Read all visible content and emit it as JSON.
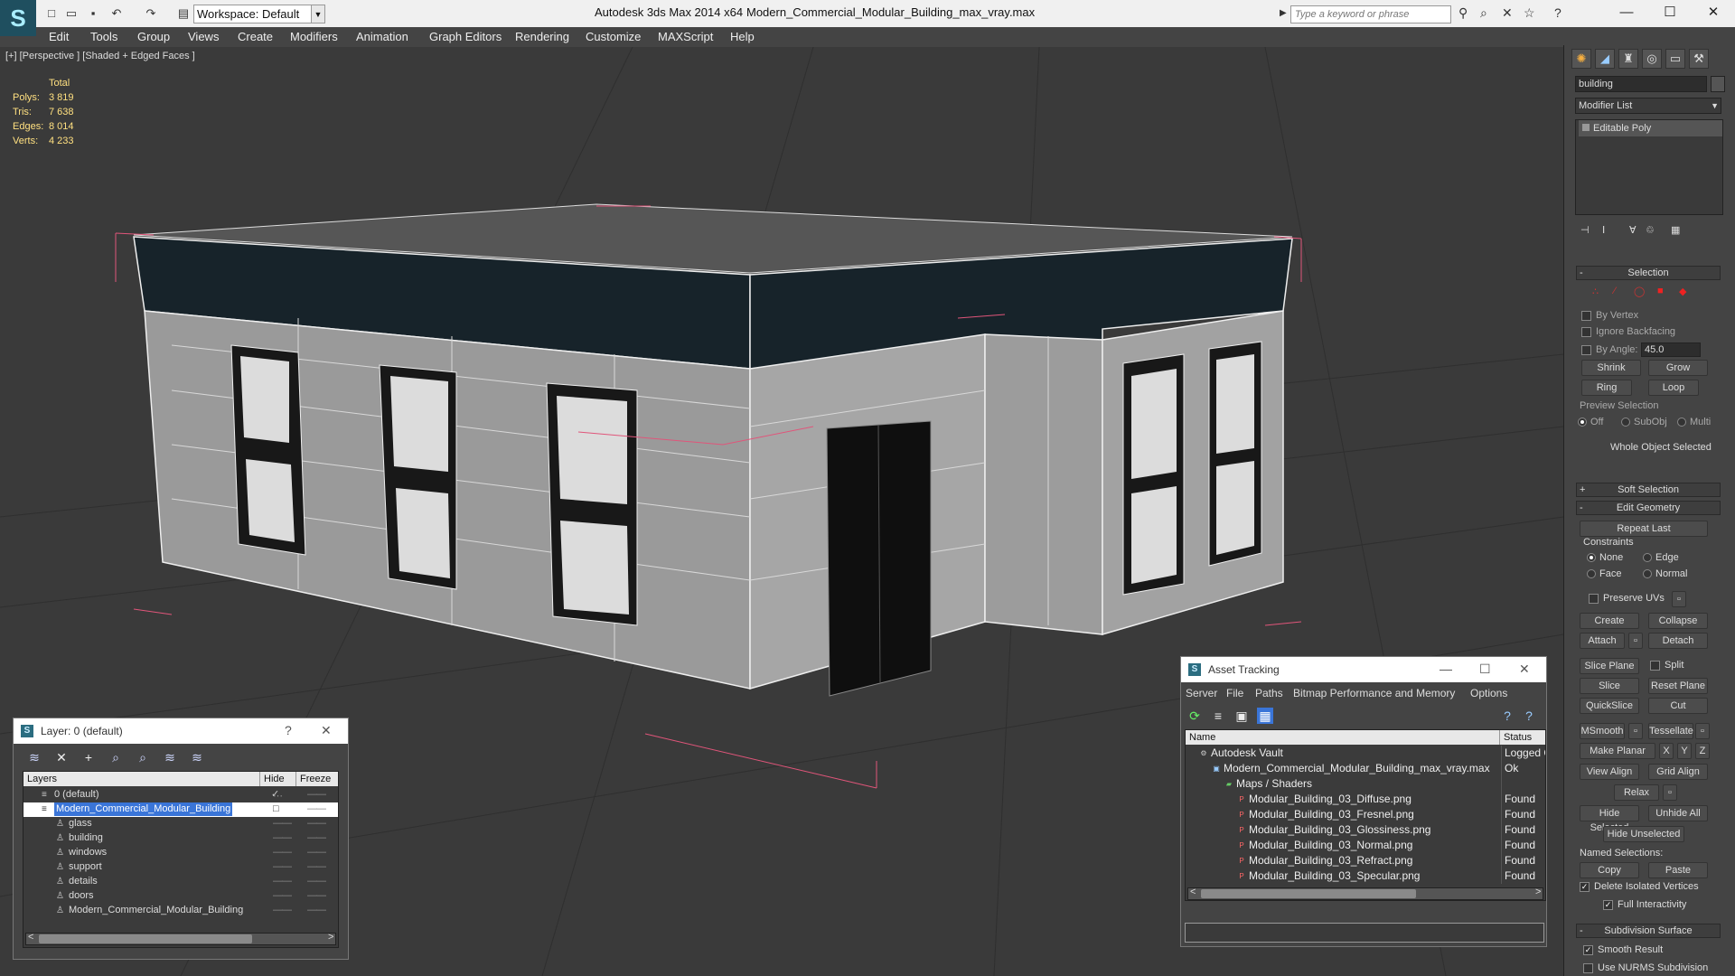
{
  "app": {
    "title": "Autodesk 3ds Max  2014 x64",
    "file": "Modern_Commercial_Modular_Building_max_vray.max",
    "logo": "3ds-max-logo"
  },
  "toolbar": {
    "workspace": "Workspace: Default",
    "search_placeholder": "Type a keyword or phrase"
  },
  "menu": [
    "Edit",
    "Tools",
    "Group",
    "Views",
    "Create",
    "Modifiers",
    "Animation",
    "Graph Editors",
    "Rendering",
    "Customize",
    "MAXScript",
    "Help"
  ],
  "viewport": {
    "label": "[+] [Perspective ] [Shaded + Edged Faces ]",
    "stats": {
      "header": "Total",
      "rows": [
        {
          "label": "Polys:",
          "value": "3 819"
        },
        {
          "label": "Tris:",
          "value": "7 638"
        },
        {
          "label": "Edges:",
          "value": "8 014"
        },
        {
          "label": "Verts:",
          "value": "4 233"
        }
      ]
    }
  },
  "command_panel": {
    "object_name": "building",
    "modifier_list": "Modifier List",
    "stack_item": "Editable Poly",
    "selection": {
      "title": "Selection",
      "by_vertex": "By Vertex",
      "ignore_backfacing": "Ignore Backfacing",
      "by_angle": "By Angle:",
      "angle": "45.0",
      "shrink": "Shrink",
      "grow": "Grow",
      "ring": "Ring",
      "loop": "Loop",
      "preview": "Preview Selection",
      "off": "Off",
      "subobj": "SubObj",
      "multi": "Multi",
      "status": "Whole Object Selected"
    },
    "soft_selection": "Soft Selection",
    "edit_geometry": {
      "title": "Edit Geometry",
      "repeat_last": "Repeat Last",
      "constraints": "Constraints",
      "none": "None",
      "edge": "Edge",
      "face": "Face",
      "normal": "Normal",
      "preserve_uvs": "Preserve UVs",
      "create": "Create",
      "collapse": "Collapse",
      "attach": "Attach",
      "detach": "Detach",
      "slice_plane": "Slice Plane",
      "split": "Split",
      "slice": "Slice",
      "reset_plane": "Reset Plane",
      "quickslice": "QuickSlice",
      "cut": "Cut",
      "msmooth": "MSmooth",
      "tessellate": "Tessellate",
      "make_planar": "Make Planar",
      "x": "X",
      "y": "Y",
      "z": "Z",
      "view_align": "View Align",
      "grid_align": "Grid Align",
      "relax": "Relax",
      "hide_selected": "Hide Selected",
      "unhide_all": "Unhide All",
      "hide_unselected": "Hide Unselected",
      "named_selections": "Named Selections:",
      "copy": "Copy",
      "paste": "Paste",
      "delete_isolated": "Delete Isolated Vertices",
      "full_interactivity": "Full Interactivity"
    },
    "subdivision": {
      "title": "Subdivision Surface",
      "smooth_result": "Smooth Result",
      "use_nurms": "Use NURMS Subdivision"
    }
  },
  "layer_window": {
    "title": "Layer: 0 (default)",
    "help": "?",
    "columns": [
      "Layers",
      "Hide",
      "Freeze"
    ],
    "rows": [
      {
        "name": "0 (default)",
        "indent": 1
      },
      {
        "name": "Modern_Commercial_Modular_Building",
        "indent": 1,
        "selected": true
      },
      {
        "name": "glass",
        "indent": 2
      },
      {
        "name": "building",
        "indent": 2
      },
      {
        "name": "windows",
        "indent": 2
      },
      {
        "name": "support",
        "indent": 2
      },
      {
        "name": "details",
        "indent": 2
      },
      {
        "name": "doors",
        "indent": 2
      },
      {
        "name": "Modern_Commercial_Modular_Building",
        "indent": 2
      }
    ]
  },
  "asset_window": {
    "title": "Asset Tracking",
    "menu": [
      "Server",
      "File",
      "Paths",
      "Bitmap Performance and Memory",
      "Options"
    ],
    "columns": [
      "Name",
      "Status"
    ],
    "rows": [
      {
        "name": "Autodesk Vault",
        "status": "Logged O",
        "indent": 0,
        "icon": "vault"
      },
      {
        "name": "Modern_Commercial_Modular_Building_max_vray.max",
        "status": "Ok",
        "indent": 1,
        "icon": "max"
      },
      {
        "name": "Maps / Shaders",
        "status": "",
        "indent": 2,
        "icon": "maps"
      },
      {
        "name": "Modular_Building_03_Diffuse.png",
        "status": "Found",
        "indent": 3,
        "icon": "png"
      },
      {
        "name": "Modular_Building_03_Fresnel.png",
        "status": "Found",
        "indent": 3,
        "icon": "png"
      },
      {
        "name": "Modular_Building_03_Glossiness.png",
        "status": "Found",
        "indent": 3,
        "icon": "png"
      },
      {
        "name": "Modular_Building_03_Normal.png",
        "status": "Found",
        "indent": 3,
        "icon": "png"
      },
      {
        "name": "Modular_Building_03_Refract.png",
        "status": "Found",
        "indent": 3,
        "icon": "png"
      },
      {
        "name": "Modular_Building_03_Specular.png",
        "status": "Found",
        "indent": 3,
        "icon": "png"
      }
    ]
  },
  "colors": {
    "selection": "#3a75d8",
    "viewport_bg": "#3a3a3a",
    "stats": "#ffe080",
    "accent": "#f8b040"
  }
}
